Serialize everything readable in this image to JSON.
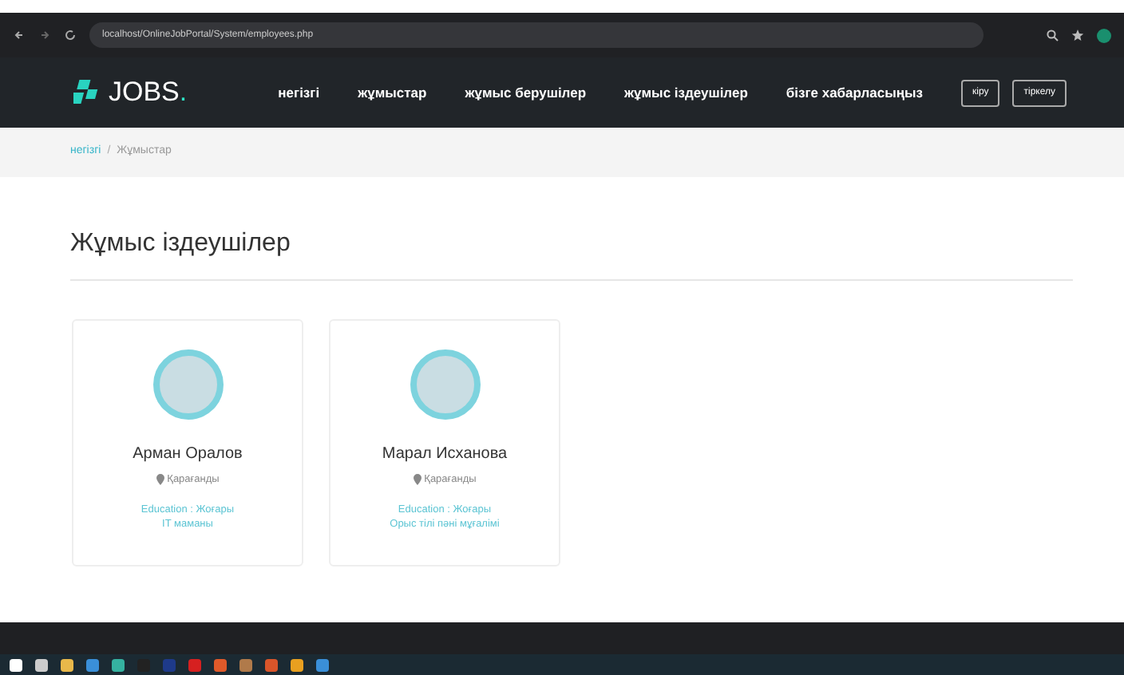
{
  "browser": {
    "url": "localhost/OnlineJobPortal/System/employees.php"
  },
  "navbar": {
    "brand": "JOBS",
    "brand_dot": ".",
    "links": [
      {
        "label": "негізгі"
      },
      {
        "label": "жұмыстар"
      },
      {
        "label": "жұмыс берушілер"
      },
      {
        "label": "жұмыс іздеушілер"
      },
      {
        "label": "бізге хабарласыңыз"
      }
    ],
    "buttons": [
      "кіру",
      "тіркелу"
    ]
  },
  "breadcrumb": [
    {
      "label": "негізгі",
      "active": false
    },
    {
      "separator": "/",
      "label": "Жұмыстар",
      "active": true
    }
  ],
  "heading": "Жұмыс іздеушілер",
  "cards": [
    {
      "name": "Арман Оралов",
      "location": "Қарағанды",
      "education_label": "Education :",
      "education": "Жоғары",
      "profession": "IT маманы"
    },
    {
      "name": "Марал Исханова",
      "location": "Қарағанды",
      "education_label": "Education :",
      "education": "Жоғары",
      "profession": "Орыс тілі пәні мұғалімі"
    }
  ]
}
